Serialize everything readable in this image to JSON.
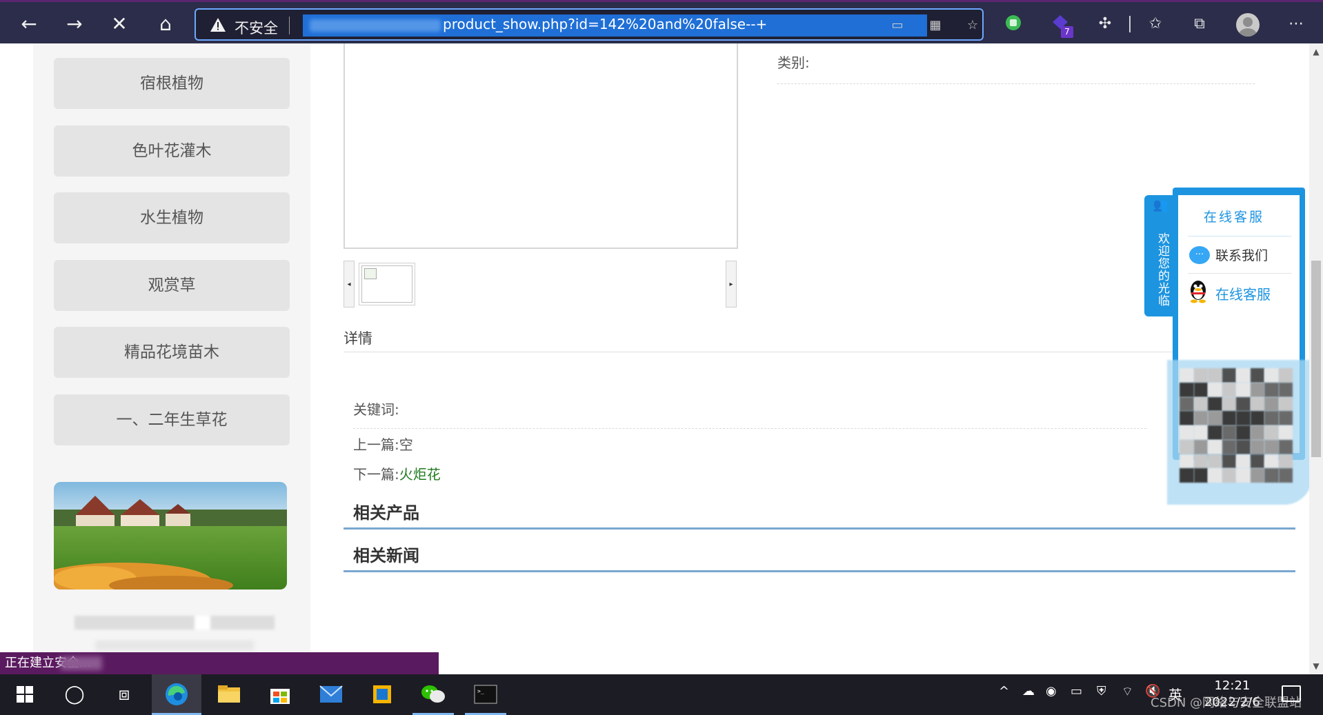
{
  "browser": {
    "security_label": "不安全",
    "url_visible": "product_show.php?id=142%20and%20false--+",
    "extension_badge": "7",
    "colors": {
      "toolbar_bg": "#2b2d4a",
      "url_highlight": "#1f6fd6",
      "address_border": "#6ea8ff"
    }
  },
  "sidebar": {
    "categories": [
      {
        "label": "宿根植物"
      },
      {
        "label": "色叶花灌木"
      },
      {
        "label": "水生植物"
      },
      {
        "label": "观赏草"
      },
      {
        "label": "精品花境苗木"
      },
      {
        "label": "一、二年生草花"
      }
    ]
  },
  "product": {
    "category_label": "类别:",
    "detail_heading": "详情",
    "keywords_label": "关键词:",
    "prev_label": "上一篇:",
    "prev_value": "空",
    "next_label": "下一篇:",
    "next_value": "火炬花",
    "next_color": "#1f7a1f",
    "related_products": "相关产品",
    "related_news": "相关新闻"
  },
  "service_widget": {
    "tab_text": "欢迎您的光临",
    "title": "在线客服",
    "contact_us": "联系我们",
    "online_service": "在线客服",
    "accent": "#1d94e0"
  },
  "status_bar": {
    "text": "正在建立安全..."
  },
  "taskbar": {
    "ime": "英",
    "time": "12:21",
    "date": "2022/2/6",
    "watermark": "CSDN @网络与安全联盟站"
  }
}
